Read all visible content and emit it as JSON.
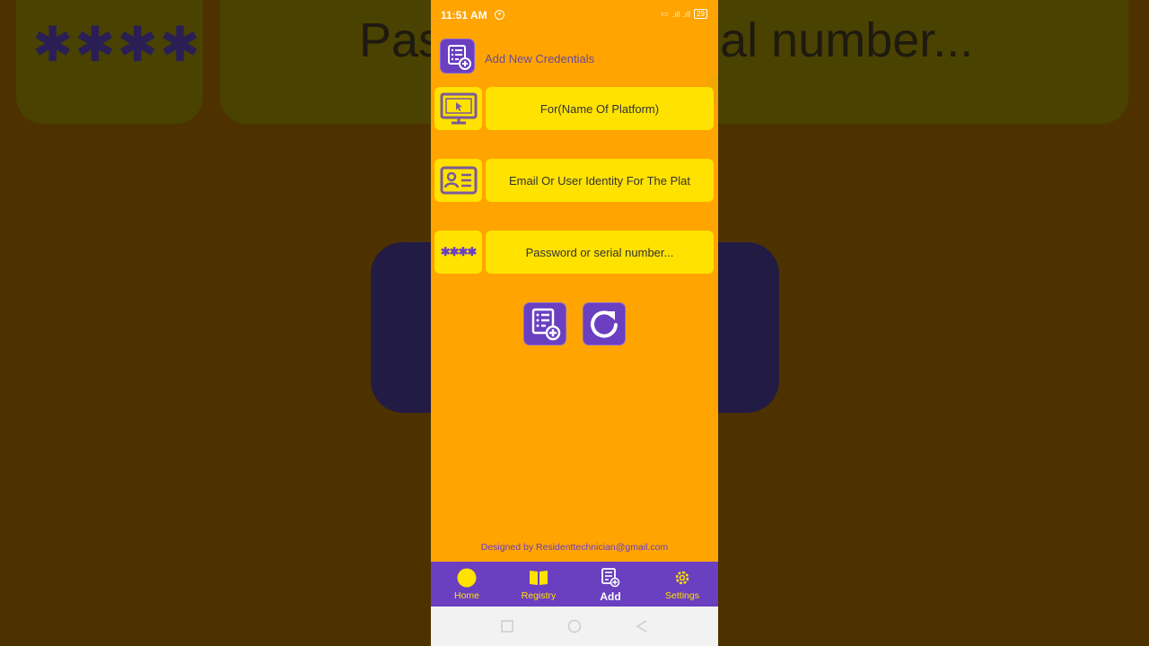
{
  "background": {
    "stars": "✱✱✱✱",
    "text": "Password or serial number..."
  },
  "status_bar": {
    "time": "11:51 AM",
    "battery": "29"
  },
  "header": {
    "title": "Add New Credentials",
    "icon": "add-list-icon"
  },
  "form": {
    "platform": {
      "placeholder": "For(Name Of Platform)",
      "icon": "monitor-icon"
    },
    "identity": {
      "placeholder": "Email Or User Identity For The Plat",
      "icon": "id-card-icon"
    },
    "password": {
      "placeholder": "Password or serial number...",
      "icon_text": "✱✱✱✱"
    }
  },
  "actions": {
    "add": "add-list-icon",
    "reset": "refresh-icon"
  },
  "footer": {
    "credit": "Designed by Residenttechnician@gmail.com"
  },
  "nav": {
    "items": [
      {
        "label": "Home",
        "icon": "circle-icon"
      },
      {
        "label": "Registry",
        "icon": "book-icon"
      },
      {
        "label": "Add",
        "icon": "add-list-icon"
      },
      {
        "label": "Settings",
        "icon": "gear-icon"
      }
    ],
    "active": "Add"
  },
  "colors": {
    "background": "#ffa400",
    "field": "#ffe200",
    "accent": "#6a3fc0"
  }
}
